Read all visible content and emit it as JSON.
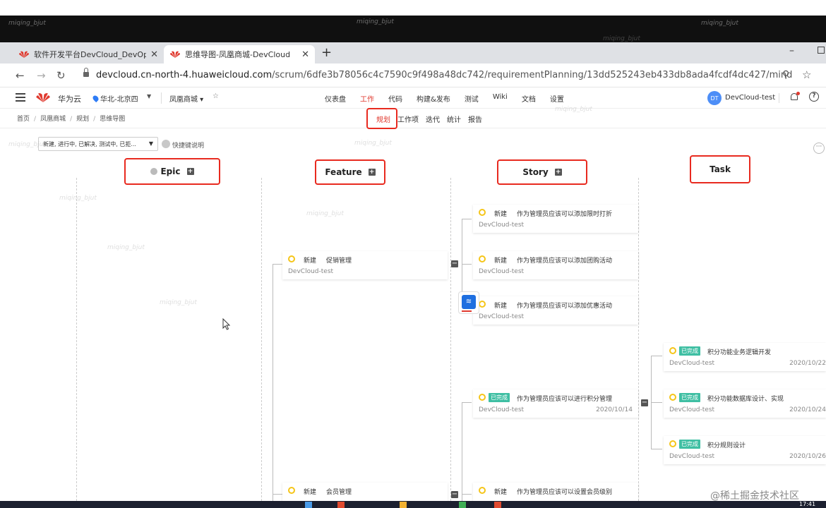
{
  "browser": {
    "tabs": [
      {
        "title": "软件开发平台DevCloud_DevOp",
        "active": false
      },
      {
        "title": "思维导图-凤凰商城-DevCloud",
        "active": true
      }
    ],
    "url_host": "devcloud.cn-north-4.huaweicloud.com",
    "url_path": "/scrum/6dfe3b78056c4c7590c9f498a48dc742/requirementPlanning/13dd525243eb433db8ada4fcdf4dc427/mind"
  },
  "header": {
    "brand": "华为云",
    "region": "华北-北京四",
    "project": "凤凰商城 ▾",
    "fav": "☆",
    "nav": [
      "仪表盘",
      "工作",
      "代码",
      "构建&发布",
      "测试",
      "Wiki",
      "文档",
      "设置"
    ],
    "nav_active": "工作",
    "avatar": "DT",
    "user": "DevCloud-test"
  },
  "subheader": {
    "breadcrumbs": [
      "首页",
      "凤凰商城",
      "规划",
      "思维导图"
    ],
    "subnav": [
      "规划",
      "工作项",
      "迭代",
      "统计",
      "报告"
    ],
    "subnav_active": "规划"
  },
  "filter": {
    "value": "新建, 进行中, 已解决, 测试中, 已拒...",
    "shortcut": "快捷键说明"
  },
  "columns": {
    "epic": "Epic",
    "feature": "Feature",
    "story": "Story",
    "task": "Task"
  },
  "features": [
    {
      "status": "新建",
      "title": "促销管理",
      "owner": "DevCloud-test"
    },
    {
      "status": "新建",
      "title": "会员管理"
    }
  ],
  "stories": [
    {
      "status": "新建",
      "title": "作为管理员应该可以添加限时打折",
      "owner": "DevCloud-test"
    },
    {
      "status": "新建",
      "title": "作为管理员应该可以添加团购活动",
      "owner": "DevCloud-test"
    },
    {
      "status": "新建",
      "title": "作为管理员应该可以添加优惠活动",
      "owner": "DevCloud-test"
    },
    {
      "badge": "已完成",
      "title": "作为管理员应该可以进行积分管理",
      "owner": "DevCloud-test",
      "date": "2020/10/14"
    },
    {
      "status": "新建",
      "title": "作为管理员应该可以设置会员级别"
    }
  ],
  "tasks": [
    {
      "badge": "已完成",
      "title": "积分功能业务逻辑开发",
      "owner": "DevCloud-test",
      "date": "2020/10/22"
    },
    {
      "badge": "已完成",
      "title": "积分功能数据库设计、实现",
      "owner": "DevCloud-test",
      "date": "2020/10/24"
    },
    {
      "badge": "已完成",
      "title": "积分规则设计",
      "owner": "DevCloud-test",
      "date": "2020/10/26"
    }
  ],
  "watermark": "miqing_bjut",
  "footer_watermark": "@稀土掘金技术社区",
  "taskbar_time": "17:41"
}
